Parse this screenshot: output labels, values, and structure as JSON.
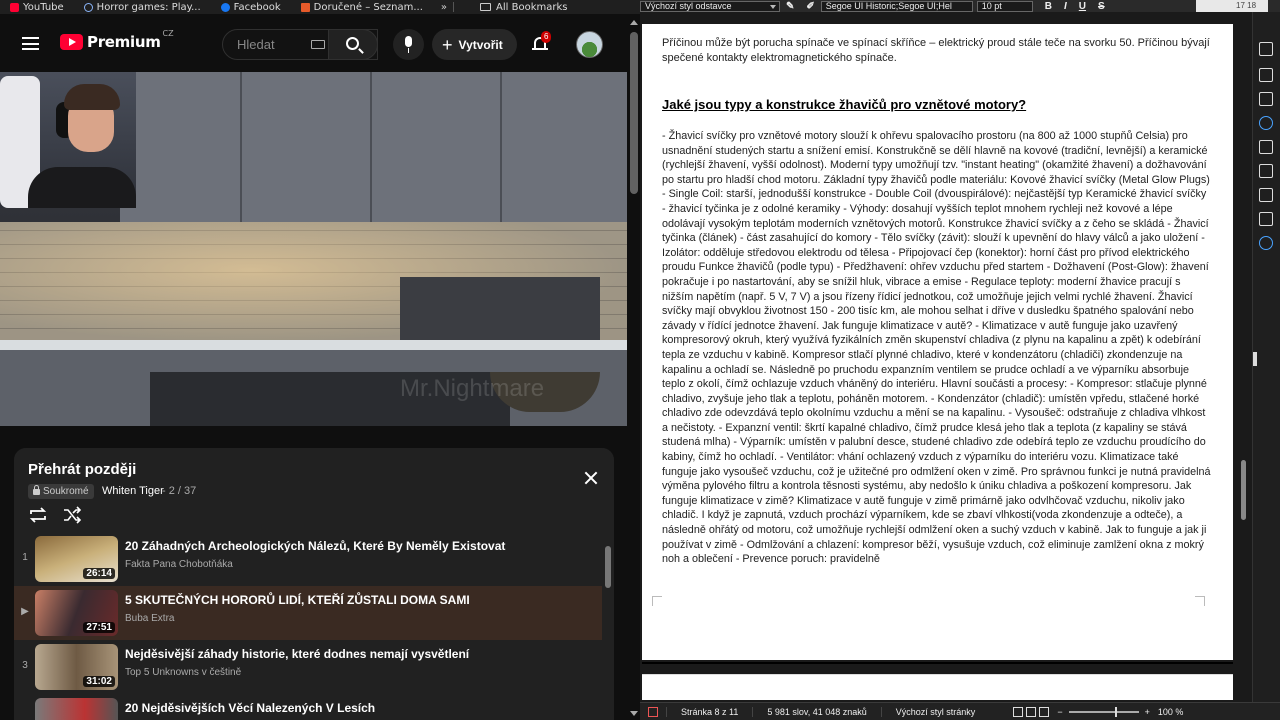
{
  "bookmarks": {
    "items": [
      {
        "label": "YouTube",
        "color": "#ff0033"
      },
      {
        "label": "Horror games: Play...",
        "color": "#3b6dd8"
      },
      {
        "label": "Facebook",
        "color": "#1877f2"
      },
      {
        "label": "Doručené – Seznam...",
        "color": "#e65a2a"
      }
    ],
    "more": "»",
    "all_bookmarks": "All Bookmarks"
  },
  "youtube": {
    "logo_text": "Premium",
    "logo_region": "CZ",
    "search_placeholder": "Hledat",
    "create_label": "Vytvořit",
    "notification_count": "6",
    "watermark": "Mr.Nightmare"
  },
  "playlist": {
    "title": "Přehrát později",
    "privacy": "Soukromé",
    "owner": "Whiten Tiger",
    "position": "- 2 / 37",
    "items": [
      {
        "index": "1",
        "title": "20 Záhadných Archeologických Nálezů, Které By Neměly Existovat",
        "channel": "Fakta Pana Chobotňáka",
        "duration": "26:14"
      },
      {
        "index": "▶",
        "title": "5 SKUTEČNÝCH HORORŮ LIDÍ, KTEŘÍ ZŮSTALI DOMA SAMI",
        "channel": "Buba Extra",
        "duration": "27:51"
      },
      {
        "index": "3",
        "title": "Nejděsivější záhady historie, které dodnes nemají vysvětlení",
        "channel": "Top 5 Unknowns v češtině",
        "duration": "31:02"
      },
      {
        "index": "",
        "title": "20 Nejděsivějších Věcí Nalezených V Lesích",
        "channel": "",
        "duration": ""
      }
    ]
  },
  "writer": {
    "paragraph_style": "Výchozí styl odstavce",
    "font_name": "Segoe UI Historic;Segoe UI;Hel",
    "font_size": "10 pt",
    "bold": "B",
    "italic": "I",
    "underline": "U",
    "strike": "S",
    "ruler_marks": "17 18",
    "doc_top_text": "Příčinou může být porucha spínače ve spínací skříňce – elektrický proud stále teče na svorku 50. Příčinou bývají spečené kontakty elektromagnetického spínače.",
    "heading": "Jaké jsou typy a konstrukce žhavičů pro vznětové motory?",
    "body": "- Žhavicí svíčky pro vznětové motory slouží k ohřevu spalovacího prostoru (na 800 až 1000 stupňů Celsia) pro usnadnění studených startu a snížení emisí. Konstrukčně se dělí hlavně na kovové (tradiční, levnější) a keramické (rychlejší žhavení, vyšší odolnost). Moderní typy umožňují tzv. \"instant heating\" (okamžité žhavení) a dožhavování po startu pro hladší chod motoru. Základní typy žhavičů podle materiálu: Kovové žhavicí svíčky (Metal Glow Plugs) - Single Coil: starší, jednodušší konstrukce - Double Coil (dvouspirálové): nejčastější typ Keramické žhavicí svíčky - žhavicí tyčinka je z odolné keramiky - Výhody: dosahují vyšších teplot mnohem rychleji než kovové a lépe odolávají vysokým teplotám moderních vznětových motorů. Konstrukce žhavicí svíčky a z čeho se skládá - Žhavicí tyčinka (článek) - část zasahující do komory - Tělo svíčky (závit): slouží k upevnění do hlavy válců a jako uložení - Izolátor: odděluje středovou elektrodu od tělesa - Připojovací čep (konektor): horní část pro přívod elektrického proudu Funkce žhavičů (podle typu) - Předžhavení: ohřev vzduchu před startem - Dožhavení (Post-Glow): žhavení pokračuje i po nastartování, aby se snížil hluk, vibrace a emise - Regulace teploty: moderní žhavice pracují s nižším napětím (např. 5 V, 7 V) a jsou řízeny řídicí jednotkou, což umožňuje jejich velmi rychlé žhavení. Žhavicí svíčky mají obvyklou životnost 150 - 200 tisíc km, ale mohou selhat i dříve v dusledku špatného spalování nebo závady v řídící jednotce žhavení. Jak funguje klimatizace v autě? - Klimatizace v autě funguje jako uzavřený kompresorový okruh, který využívá fyzikálních změn skupenství chladiva (z plynu na kapalinu a zpět) k odebírání tepla ze vzduchu v kabině. Kompresor stlačí plynné chladivo, které v kondenzátoru (chladiči) zkondenzuje na kapalinu a ochladí se. Následně po pruchodu expanzním ventilem se prudce ochladí a ve výparníku absorbuje teplo z okolí, čímž ochlazuje vzduch vháněný do interiéru. Hlavní součásti a procesy: - Kompresor: stlačuje plynné chladivo, zvyšuje jeho tlak a teplotu, poháněn motorem. - Kondenzátor (chladič): umístěn vpředu, stlačené horké chladivo zde odevzdává teplo okolnímu vzduchu a mění se na kapalinu. - Vysoušeč: odstraňuje z chladiva vlhkost a nečistoty. - Expanzní ventil: škrtí kapalné chladivo, čímž prudce klesá jeho tlak a teplota (z kapaliny se stává studená mlha) - Výparník: umístěn v palubní desce, studené chladivo zde odebírá teplo ze vzduchu proudícího do kabiny, čímž ho ochladí. - Ventilátor: vhání ochlazený vzduch z výparníku do interiéru vozu. Klimatizace také funguje jako vysoušeč vzduchu, což je užitečné pro odmlžení oken v zimě. Pro správnou funkci je nutná pravidelná výměna pylového filtru a kontrola těsnosti systému, aby nedošlo k úniku chladiva a poškození kompresoru. Jak funguje klimatizace v zimě? Klimatizace v autě funguje v zimě primárně jako odvlhčovač vzduchu, nikoliv jako chladič. I když je zapnutá, vzduch prochází výparníkem, kde se zbaví vlhkosti(voda zkondenzuje a odteče), a následně ohřátý od motoru, což umožňuje rychlejší odmlžení oken a suchý vzduch v kabině. Jak to funguje a jak ji používat v zimě - Odmlžování a chlazení: kompresor běží, vysušuje vzduch, což eliminuje zamlžení okna z mokrý noh a oblečení - Prevence poruch: pravidelně",
    "status": {
      "page": "Stránka 8 z 11",
      "words": "5 981 slov, 41 048 znaků",
      "page_style": "Výchozí styl stránky",
      "zoom": "100 %"
    }
  }
}
